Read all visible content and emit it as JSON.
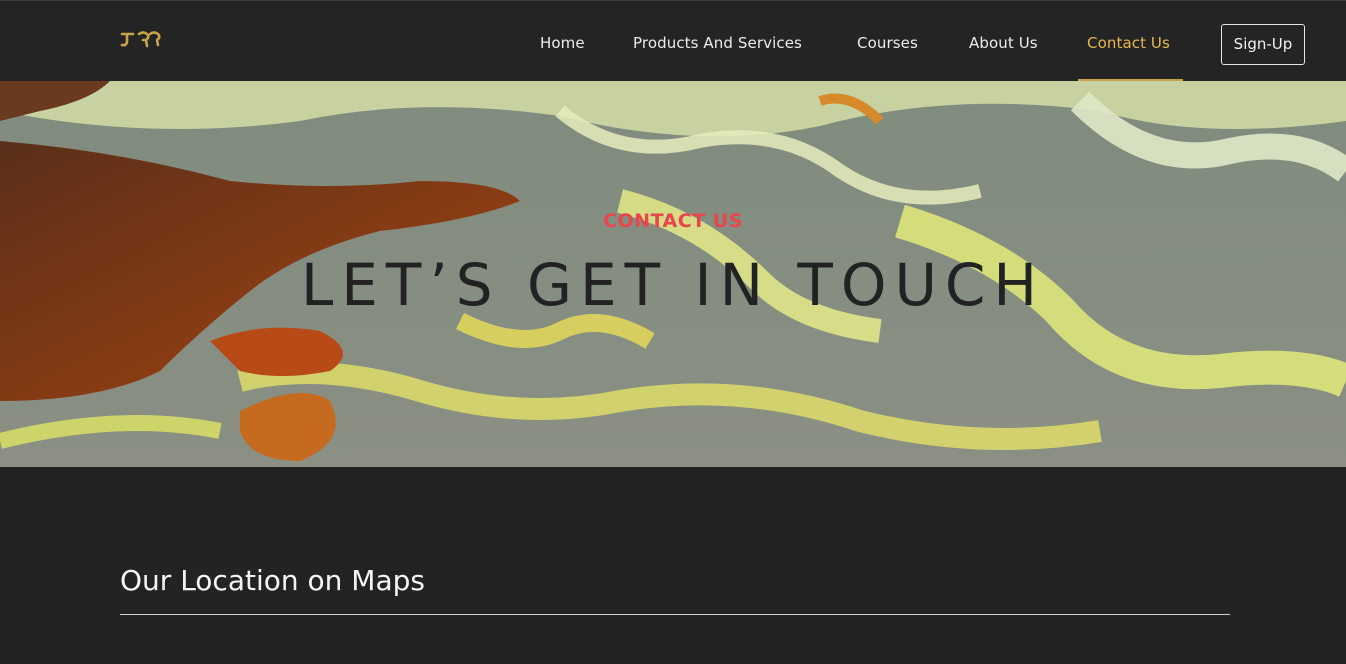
{
  "header": {
    "logo_icon": "brand-logo-icon",
    "nav": [
      {
        "label": "Home",
        "active": false
      },
      {
        "label": "Products And Services",
        "active": false
      },
      {
        "label": "Courses",
        "active": false
      },
      {
        "label": "About Us",
        "active": false
      },
      {
        "label": "Contact Us",
        "active": true
      }
    ],
    "signup_label": "Sign-Up",
    "active_color": "#e8b84d"
  },
  "hero": {
    "kicker": "CONTACT US",
    "title": "LET’S GET IN TOUCH",
    "kicker_color": "#e8454d"
  },
  "section": {
    "title": "Our Location on Maps"
  }
}
